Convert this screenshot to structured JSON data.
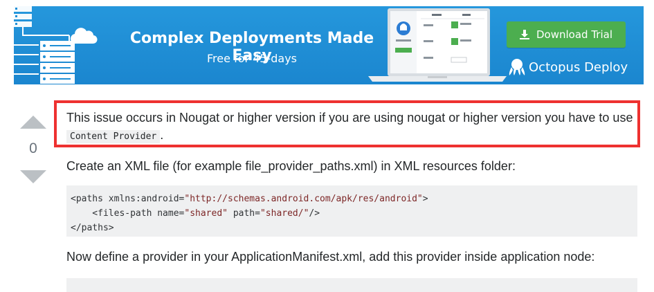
{
  "ad": {
    "headline": "Complex Deployments Made Easy",
    "subline": "Free for 45-days",
    "button_label": "Download Trial",
    "brand_name": "Octopus Deploy",
    "background_color": "#1f8fd6",
    "button_color": "#4cae4f"
  },
  "vote": {
    "count": "0"
  },
  "answer": {
    "intro_text": "This issue occurs in Nougat or higher version if you are using nougat or higher version you have to use ",
    "intro_code": "Content Provider",
    "intro_end": ".",
    "step1_text": "Create an XML file (for example file_provider_paths.xml) in XML resources folder:",
    "code_block": {
      "line1_open": "<paths xmlns:android=",
      "line1_str": "\"http://schemas.android.com/apk/res/android\"",
      "line1_close": ">",
      "line2_open": "    <files-path name=",
      "line2_str1": "\"shared\"",
      "line2_mid": " path=",
      "line2_str2": "\"shared/\"",
      "line2_close": "/>",
      "line3": "</paths>"
    },
    "step2_text": "Now define a provider in your ApplicationManifest.xml, add this provider inside application node:",
    "highlight_color": "#ee3130"
  }
}
